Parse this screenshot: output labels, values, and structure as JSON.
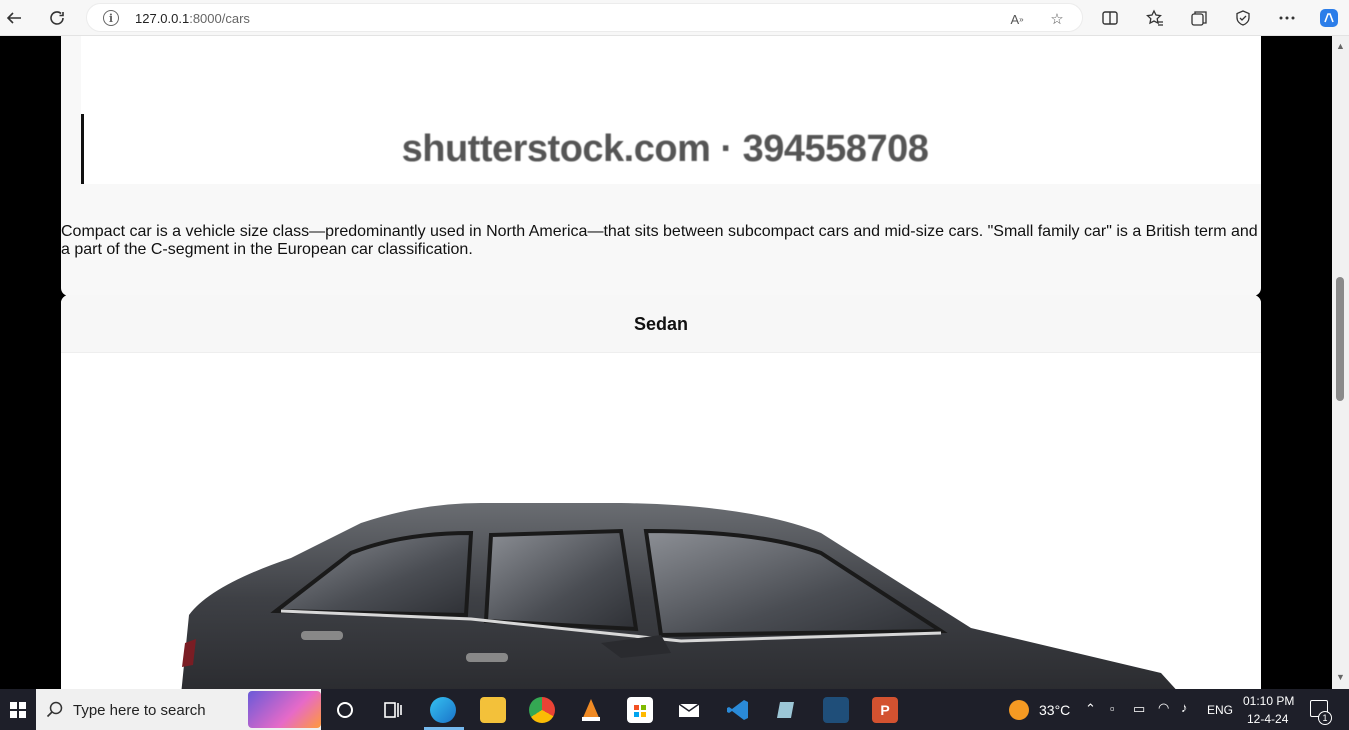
{
  "browser": {
    "url_host": "127.0.0.1",
    "url_path": ":8000/cars"
  },
  "page": {
    "card1": {
      "watermark": "shutterstock.com · 394558708",
      "description": "Compact car is a vehicle size class—predominantly used in North America—that sits between subcompact cars and mid-size cars. \"Small family car\" is a British term and a part of the C-segment in the European car classification."
    },
    "card2": {
      "title": "Sedan"
    }
  },
  "taskbar": {
    "search_placeholder": "Type here to search",
    "weather": "33°C",
    "language": "ENG",
    "time": "01:10 PM",
    "date": "12-4-24",
    "notification_count": "1"
  }
}
